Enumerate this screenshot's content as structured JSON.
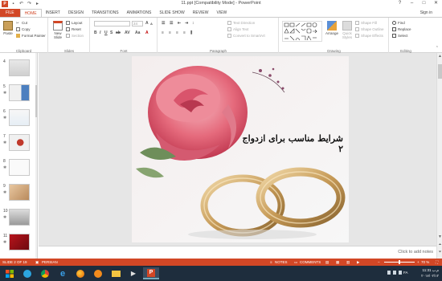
{
  "titlebar": {
    "title": "11.ppt [Compatibility Mode] - PowerPoint",
    "app_logo": "P",
    "qat_icons": [
      "save-icon",
      "undo-icon",
      "redo-icon",
      "start-from-beginning-icon"
    ],
    "help": "?",
    "minimize": "–",
    "maximize": "□",
    "close": "✕"
  },
  "tabs": [
    {
      "label": "FILE"
    },
    {
      "label": "HOME"
    },
    {
      "label": "INSERT"
    },
    {
      "label": "DESIGN"
    },
    {
      "label": "TRANSITIONS"
    },
    {
      "label": "ANIMATIONS"
    },
    {
      "label": "SLIDE SHOW"
    },
    {
      "label": "REVIEW"
    },
    {
      "label": "VIEW"
    }
  ],
  "signin": "Sign in",
  "ribbon": {
    "clipboard": {
      "label": "Clipboard",
      "paste": "Paste",
      "cut": "Cut",
      "copy": "Copy",
      "format_painter": "Format Painter"
    },
    "slides": {
      "label": "Slides",
      "new_slide": "New Slide",
      "layout": "Layout",
      "reset": "Reset",
      "section": "Section"
    },
    "font": {
      "label": "Font",
      "size_value": "24"
    },
    "paragraph": {
      "label": "Paragraph",
      "text_direction": "Text Direction",
      "align_text": "Align Text",
      "convert_smartart": "Convert to SmartArt"
    },
    "drawing": {
      "label": "Drawing",
      "arrange": "Arrange",
      "quick_styles": "Quick Styles",
      "shape_fill": "Shape Fill",
      "shape_outline": "Shape Outline",
      "shape_effects": "Shape Effects"
    },
    "editing": {
      "label": "Editing",
      "find": "Find",
      "replace": "Replace",
      "select": "Select"
    }
  },
  "thumbnails": [
    {
      "num": "4"
    },
    {
      "num": "5"
    },
    {
      "num": "6"
    },
    {
      "num": "7"
    },
    {
      "num": "8"
    },
    {
      "num": "9"
    },
    {
      "num": "10"
    },
    {
      "num": "11"
    }
  ],
  "slide": {
    "title": "شرایط مناسب برای ازدواج ۲"
  },
  "notes": {
    "placeholder": "Click to add notes"
  },
  "statusbar": {
    "slide_info": "SLIDE 2 OF 19",
    "language": "PERSIAN",
    "notes": "NOTES",
    "comments": "COMMENTS",
    "zoom": "70 %"
  },
  "taskbar": {
    "time": "11:31 م.ب",
    "date": "۲۰۱۷/۰۲/۱۲",
    "lang": "FA"
  }
}
